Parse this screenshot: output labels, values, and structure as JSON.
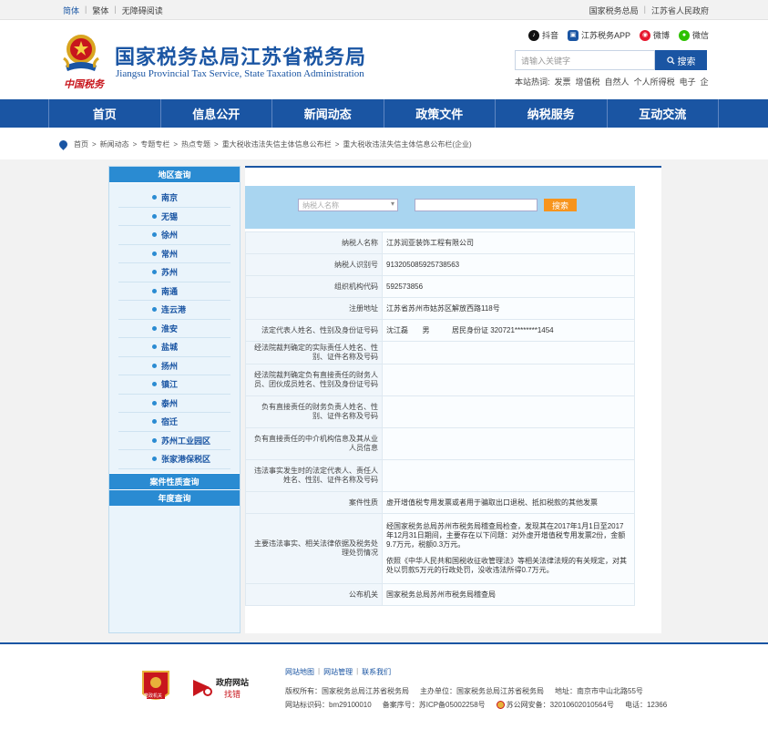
{
  "topbar": {
    "lang_simplified": "简体",
    "lang_traditional": "繁体",
    "accessible": "无障碍阅读",
    "link_sat": "国家税务总局",
    "link_gov": "江苏省人民政府"
  },
  "header": {
    "brand_logo_text": "中国税务",
    "title_cn": "国家税务总局江苏省税务局",
    "title_en": "Jiangsu Provincial Tax Service, State Taxation Administration",
    "social": [
      "抖音",
      "江苏税务APP",
      "微博",
      "微信"
    ],
    "search_placeholder": "请输入关键字",
    "search_button": "搜索",
    "hot_label": "本站热词:",
    "hot_words": [
      "发票",
      "增值税",
      "自然人",
      "个人所得税",
      "电子",
      "企"
    ]
  },
  "nav": [
    "首页",
    "信息公开",
    "新闻动态",
    "政策文件",
    "纳税服务",
    "互动交流"
  ],
  "breadcrumb": [
    "首页",
    "新闻动态",
    "专题专栏",
    "热点专题",
    "重大税收违法失信主体信息公布栏",
    "重大税收违法失信主体信息公布栏(企业)"
  ],
  "sidebar": {
    "region_header": "地区查询",
    "regions": [
      "南京",
      "无锡",
      "徐州",
      "常州",
      "苏州",
      "南通",
      "连云港",
      "淮安",
      "盐城",
      "扬州",
      "镇江",
      "泰州",
      "宿迁",
      "苏州工业园区",
      "张家港保税区"
    ],
    "case_header": "案件性质查询",
    "year_header": "年度查询"
  },
  "query": {
    "select_placeholder": "纳税人名称",
    "button": "搜索"
  },
  "record": [
    {
      "label": "纳税人名称",
      "value": "江苏润亚装饰工程有限公司"
    },
    {
      "label": "纳税人识别号",
      "value": "913205085925738563"
    },
    {
      "label": "组织机构代码",
      "value": "592573856"
    },
    {
      "label": "注册地址",
      "value": "江苏省苏州市姑苏区解放西路118号"
    },
    {
      "label": "法定代表人姓名、性别及身份证号码",
      "value": "沈江磊       男           居民身份证 320721********1454"
    },
    {
      "label": "经法院裁判确定的实际责任人姓名、性别、证件名称及号码",
      "value": ""
    },
    {
      "label": "经法院裁判确定负有直接责任的财务人员、团伙成员姓名、性别及身份证号码",
      "value": ""
    },
    {
      "label": "负有直接责任的财务负责人姓名、性别、证件名称及号码",
      "value": ""
    },
    {
      "label": "负有直接责任的中介机构信息及其从业人员信息",
      "value": ""
    },
    {
      "label": "违法事实发生时的法定代表人、责任人姓名、性别、证件名称及号码",
      "value": ""
    },
    {
      "label": "案件性质",
      "value": "虚开增值税专用发票或者用于骗取出口退税、抵扣税款的其他发票"
    },
    {
      "label": "主要违法事实、相关法律依据及税务处理处罚情况",
      "value": "经国家税务总局苏州市税务局稽查局检查，发现其在2017年1月1日至2017年12月31日期间，主要存在以下问题：对外虚开增值税专用发票2份，金额9.7万元，税额0.3万元。",
      "value2": "依照《中华人民共和国税收征收管理法》等相关法律法规的有关规定，对其处以罚款5万元的行政处罚，没收违法所得0.7万元。"
    },
    {
      "label": "公布机关",
      "value": "国家税务总局苏州市税务局稽查局"
    }
  ],
  "footer": {
    "badge_text": "党政机关",
    "gov_site_text": "政府网站",
    "gov_site_sub": "找错",
    "links": [
      "网站地图",
      "网站管理",
      "联系我们"
    ],
    "copyright_label": "版权所有：国家税务总局江苏省税务局",
    "sponsor": "主办单位：国家税务总局江苏省税务局",
    "address": "地址：南京市中山北路55号",
    "site_code": "网站标识码：bm29100010",
    "icp": "备案序号：苏ICP备05002258号",
    "police": "苏公网安备：32010602010564号",
    "phone": "电话：12366"
  },
  "colors": {
    "primary": "#1a55a3",
    "sidebar_header": "#2a8bd2",
    "search_orange": "#f7941d",
    "query_bar": "#a9d5f0"
  }
}
